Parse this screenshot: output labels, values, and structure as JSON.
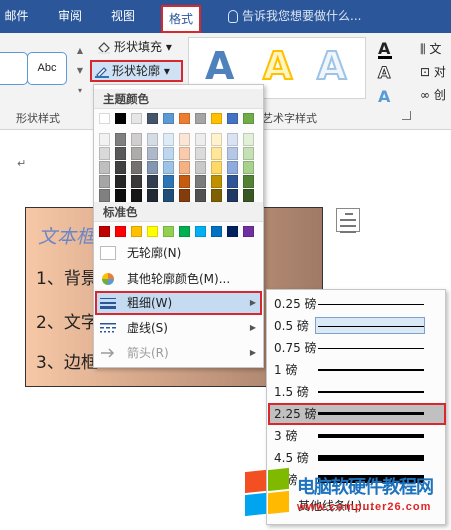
{
  "tabs": [
    {
      "label": "邮件"
    },
    {
      "label": "审阅"
    },
    {
      "label": "视图"
    },
    {
      "label": "格式"
    }
  ],
  "tell_me": "告诉我您想要做什么...",
  "ribbon": {
    "shape_preview_label": "Abc",
    "shape_fill": "形状填充",
    "shape_outline": "形状轮廓",
    "group_shape_styles": "形状样式",
    "group_wordart": "艺术字样式",
    "wordart_letter": "A",
    "text_fill_letter": "A",
    "right_labels": [
      "文",
      "对",
      "创"
    ]
  },
  "document": {
    "para_mark": "↵",
    "textbox_title": "文本框",
    "textbox_lines": [
      "1、背景",
      "2、文字",
      "3、边框"
    ]
  },
  "outline_menu": {
    "theme_colors_header": "主题颜色",
    "standard_colors_header": "标准色",
    "no_outline": "无轮廓(N)",
    "more_colors": "其他轮廓颜色(M)...",
    "weight": "粗细(W)",
    "dashes": "虚线(S)",
    "arrows": "箭头(R)",
    "theme_colors": [
      [
        "#ffffff",
        "#000000",
        "#e7e6e6",
        "#44546a",
        "#5b9bd5",
        "#ed7d31",
        "#a5a5a5",
        "#ffc000",
        "#4472c4",
        "#70ad47"
      ],
      [
        "#f2f2f2",
        "#7f7f7f",
        "#d0cece",
        "#d6dce4",
        "#ddebf7",
        "#fbe5d6",
        "#ededed",
        "#fff2cc",
        "#dae3f3",
        "#e2f0d9"
      ],
      [
        "#d9d9d9",
        "#595959",
        "#aeabab",
        "#adb9ca",
        "#bdd7ee",
        "#f8cbad",
        "#dbdbdb",
        "#ffe699",
        "#b4c7e7",
        "#c5e0b4"
      ],
      [
        "#bfbfbf",
        "#404040",
        "#757171",
        "#8497b0",
        "#9dc3e6",
        "#f4b183",
        "#c9c9c9",
        "#ffd966",
        "#8faadc",
        "#a9d18e"
      ],
      [
        "#a6a6a6",
        "#262626",
        "#3a3838",
        "#333f50",
        "#2e75b6",
        "#c55a11",
        "#7b7b7b",
        "#bf9000",
        "#2f5597",
        "#548235"
      ],
      [
        "#808080",
        "#0d0d0d",
        "#171616",
        "#222a35",
        "#1f4e79",
        "#843c0c",
        "#525252",
        "#7f6000",
        "#203864",
        "#385723"
      ]
    ],
    "standard_colors": [
      "#c00000",
      "#ff0000",
      "#ffc000",
      "#ffff00",
      "#92d050",
      "#00b050",
      "#00b0f0",
      "#0070c0",
      "#002060",
      "#7030a0"
    ]
  },
  "weight_menu": {
    "items": [
      {
        "label": "0.25 磅",
        "current": false,
        "highlighted": false
      },
      {
        "label": "0.5 磅",
        "current": true,
        "highlighted": false
      },
      {
        "label": "0.75 磅",
        "current": false,
        "highlighted": false
      },
      {
        "label": "1 磅",
        "current": false,
        "highlighted": false
      },
      {
        "label": "1.5 磅",
        "current": false,
        "highlighted": false
      },
      {
        "label": "2.25 磅",
        "current": false,
        "highlighted": true
      },
      {
        "label": "3 磅",
        "current": false,
        "highlighted": false
      },
      {
        "label": "4.5 磅",
        "current": false,
        "highlighted": false
      },
      {
        "label": "6 磅",
        "current": false,
        "highlighted": false
      }
    ],
    "more_lines": "其他线条(L)..."
  },
  "watermark": {
    "name": "电脑软硬件教程网",
    "url": "www.computer26.com"
  },
  "colors": {
    "ribbon_blue": "#2b579a",
    "highlight_red": "#d9272e",
    "menu_highlight": "#c5dbf2"
  }
}
